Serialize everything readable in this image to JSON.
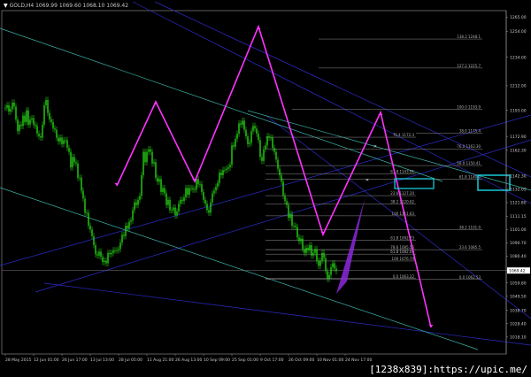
{
  "header": {
    "title": "GOLD,H4 1069.99 1069.60 1068.10 1069.42"
  },
  "watermark": "[1238x839]:https://upic.me/",
  "colors": {
    "background": "#000000",
    "candles": "#27d414",
    "zigzag": "#ff33ff",
    "channel_blue": "#2c2cc8",
    "channel_teal": "#3cb4a8",
    "fib": "#8c8c8c",
    "box": "#19d7e6",
    "wedge": "#8c28dc"
  },
  "chart_data": {
    "type": "line",
    "title": "",
    "xlabel": "",
    "ylabel": "",
    "ylim": [
      1005,
      1270
    ],
    "x_ticks": [
      "28 May 2015",
      "12 Jun 01:00",
      "26 Jun 17:00",
      "13 Jul 13:00",
      "28 Jul 05:00",
      "11 Aug 21:00",
      "26 Aug 13:00",
      "10 Sep 09:00",
      "25 Sep 01:00",
      "9 Oct 17:00",
      "26 Oct 09:00",
      "10 Nov 01:00",
      "24 Nov 17:00"
    ],
    "y_ticks": [
      1265.0,
      1254.0,
      1234.0,
      1212.0,
      1193.0,
      1172.9,
      1162.3,
      1142.3,
      1132.05,
      1121.8,
      1111.15,
      1101.0,
      1090.7,
      1080.4,
      1069.42,
      1059.8,
      1049.5,
      1038.7,
      1028.4,
      1018.1
    ],
    "current_price": 1069.42,
    "series": [
      {
        "type": "candles",
        "x": [
          0,
          2,
          4,
          6,
          8,
          10,
          12,
          14,
          16,
          18,
          20,
          22,
          24,
          26,
          28,
          30,
          32,
          34,
          36,
          38,
          40,
          42,
          44,
          46,
          48,
          50,
          52,
          54,
          56,
          58,
          60,
          62,
          64,
          66,
          68,
          70,
          72,
          74,
          76,
          78,
          80,
          82,
          84,
          86,
          88,
          90,
          92,
          94,
          96,
          98,
          100,
          102,
          104,
          106,
          108,
          110,
          112,
          114,
          116,
          118,
          120,
          122,
          124,
          126,
          128,
          130,
          132,
          134,
          136,
          138,
          140,
          142,
          144,
          146,
          148,
          150,
          152,
          154,
          156,
          158,
          160,
          162,
          164,
          166,
          168,
          170,
          172,
          174,
          176,
          178,
          180,
          182,
          184,
          186,
          188,
          190,
          192,
          194,
          196,
          198,
          200,
          202,
          204,
          206,
          208,
          210,
          212,
          214,
          216,
          218,
          220,
          222,
          224,
          226,
          228,
          230,
          232,
          234,
          236,
          238,
          240,
          242,
          244,
          246,
          248,
          250,
          252,
          254,
          256,
          258,
          260,
          262,
          264,
          266,
          268,
          270,
          272,
          274,
          276,
          278,
          280,
          282,
          284,
          286,
          288,
          290,
          292,
          294,
          296,
          298,
          300,
          302,
          304,
          306,
          308,
          310,
          312,
          314,
          316,
          318,
          320,
          322,
          324,
          326,
          328,
          330,
          332,
          334,
          336,
          338,
          340,
          342,
          344,
          346,
          348,
          350,
          352,
          354,
          356,
          358,
          360,
          362,
          364,
          366,
          368,
          370,
          372,
          374,
          376,
          378,
          380,
          382,
          384,
          386
        ],
        "close": [
          1195,
          1197,
          1192,
          1194,
          1199,
          1196,
          1186,
          1177,
          1182,
          1181,
          1189,
          1184,
          1193,
          1182,
          1186,
          1187,
          1182,
          1181,
          1175,
          1173,
          1172,
          1182,
          1197,
          1201,
          1191,
          1186,
          1184,
          1179,
          1178,
          1172,
          1169,
          1172,
          1167,
          1170,
          1170,
          1164,
          1161,
          1149,
          1157,
          1153,
          1152,
          1141,
          1141,
          1131,
          1125,
          1114,
          1114,
          1104,
          1101,
          1096,
          1089,
          1082,
          1081,
          1084,
          1080,
          1076,
          1077,
          1075,
          1083,
          1082,
          1083,
          1085,
          1085,
          1085,
          1086,
          1091,
          1097,
          1096,
          1104,
          1102,
          1107,
          1108,
          1116,
          1122,
          1120,
          1124,
          1127,
          1143,
          1161,
          1153,
          1161,
          1163,
          1161,
          1152,
          1153,
          1141,
          1138,
          1140,
          1130,
          1133,
          1129,
          1120,
          1124,
          1116,
          1116,
          1118,
          1112,
          1115,
          1121,
          1124,
          1123,
          1126,
          1133,
          1128,
          1133,
          1133,
          1132,
          1132,
          1140,
          1136,
          1136,
          1130,
          1124,
          1121,
          1116,
          1114,
          1122,
          1129,
          1131,
          1134,
          1137,
          1145,
          1143,
          1147,
          1147,
          1148,
          1149,
          1151,
          1166,
          1165,
          1171,
          1175,
          1183,
          1182,
          1185,
          1178,
          1173,
          1167,
          1168,
          1177,
          1181,
          1179,
          1175,
          1170,
          1157,
          1154,
          1163,
          1166,
          1173,
          1172,
          1172,
          1164,
          1161,
          1155,
          1148,
          1143,
          1138,
          1127,
          1123,
          1120,
          1110,
          1113,
          1104,
          1104,
          1103,
          1095,
          1092,
          1094,
          1086,
          1083,
          1087,
          1085,
          1089,
          1081,
          1083,
          1086,
          1077,
          1073,
          1077,
          1083,
          1079,
          1069,
          1063,
          1066,
          1072,
          1075,
          1071,
          1069
        ]
      }
    ],
    "fib_levels": [
      {
        "label": "138.2 1248.1",
        "y": 1248.1
      },
      {
        "label": "127.2 1225.7",
        "y": 1225.7
      },
      {
        "label": "100.0 1193.9",
        "y": 1193.9
      },
      {
        "label": "76.4 1172.3",
        "y": 1172.3
      },
      {
        "label": "38.0 1175.4",
        "y": 1175.4
      },
      {
        "label": "61.8 1143.91",
        "y": 1143.91
      },
      {
        "label": "76.0 1163.30",
        "y": 1163.3
      },
      {
        "label": "50.0 1150.41",
        "y": 1150.41
      },
      {
        "label": "61.8 1140.0",
        "y": 1140.0
      },
      {
        "label": "23.6 1127.20",
        "y": 1127.2
      },
      {
        "label": "38.2 1120.62",
        "y": 1120.62
      },
      {
        "label": "100 1111.63",
        "y": 1111.63
      },
      {
        "label": "38.2 1101.0",
        "y": 1101.0
      },
      {
        "label": "61.8 1092.73",
        "y": 1092.73
      },
      {
        "label": "78.6 1085.56",
        "y": 1085.56
      },
      {
        "label": "23.6 1085.5",
        "y": 1085.5
      },
      {
        "label": "61.8 1082.06",
        "y": 1082.06
      },
      {
        "label": "100 1076.74",
        "y": 1076.74
      },
      {
        "label": "0.0 1062.53",
        "y": 1062.53
      },
      {
        "label": "0.0 1063.22",
        "y": 1063.22
      }
    ]
  }
}
